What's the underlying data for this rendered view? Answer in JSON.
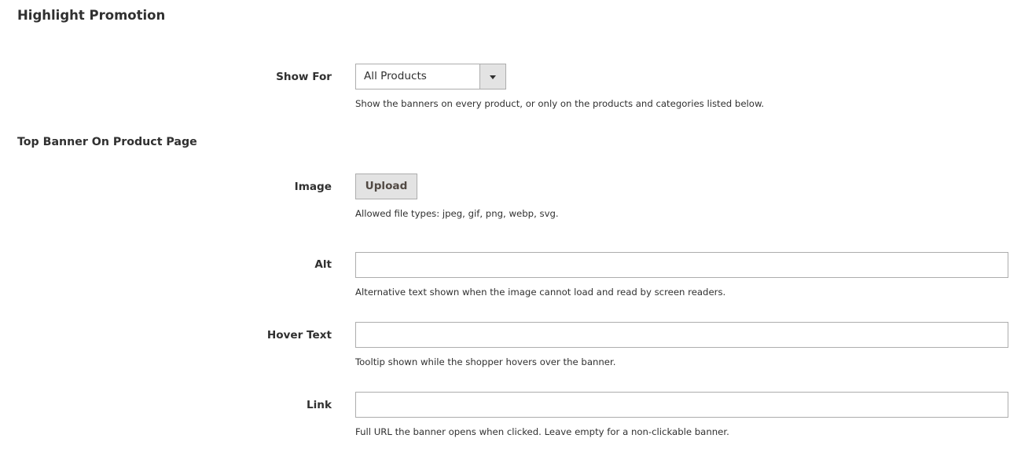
{
  "sections": {
    "highlight_title": "Highlight Promotion",
    "top_banner_title": "Top Banner On Product Page"
  },
  "show_for": {
    "label": "Show For",
    "value": "All Products",
    "note": "Show the banners on every product, or only on the products and categories listed below."
  },
  "image": {
    "label": "Image",
    "button_label": "Upload",
    "note": "Allowed file types: jpeg, gif, png, webp, svg."
  },
  "alt": {
    "label": "Alt",
    "value": "",
    "note": "Alternative text shown when the image cannot load and read by screen readers."
  },
  "hover_text": {
    "label": "Hover Text",
    "value": "",
    "note": "Tooltip shown while the shopper hovers over the banner."
  },
  "link": {
    "label": "Link",
    "value": "",
    "note": "Full URL the banner opens when clicked. Leave empty for a non-clickable banner."
  },
  "icons": {
    "select_arrow": "chevron-down-icon"
  }
}
